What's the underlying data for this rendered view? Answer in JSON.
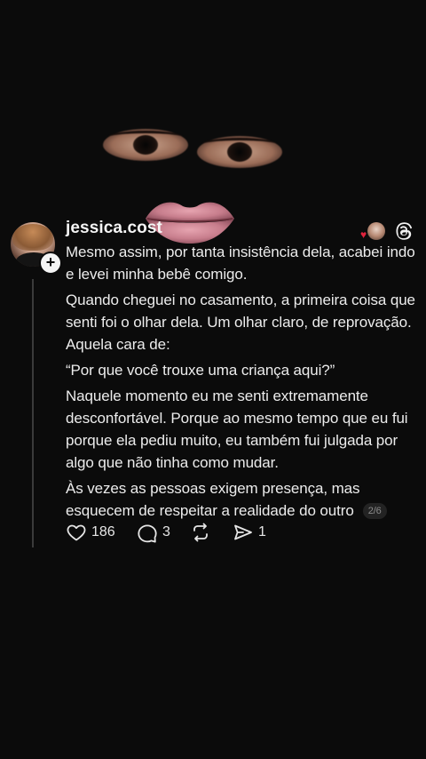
{
  "post": {
    "username": "jessica.cost",
    "paragraphs": [
      "Mesmo assim, por tanta insistência dela, acabei indo e levei minha bebê comigo.",
      "Quando cheguei no casamento, a primeira coisa que senti foi o olhar dela. Um olhar claro, de reprovação. Aquela cara de:",
      "“Por que você trouxe uma criança aqui?”",
      "Naquele momento eu me senti extremamente desconfortável. Porque ao mesmo tempo que eu fui porque ela pediu muito, eu também fui julgada por algo que não tinha como mudar.",
      "Às vezes as pessoas exigem presença, mas esquecem de respeitar a realidade do outro"
    ],
    "page_indicator": "2/6"
  },
  "actions": {
    "likes": "186",
    "replies": "3",
    "shares": "1"
  },
  "icons": {
    "like": "heart-icon",
    "reply": "comment-icon",
    "repost": "repost-icon",
    "share": "send-icon",
    "app": "threads-logo-icon",
    "follow": "plus-icon"
  },
  "colors": {
    "background": "#0b0b0b",
    "text": "#ececec",
    "heart_badge": "#e0233c"
  }
}
